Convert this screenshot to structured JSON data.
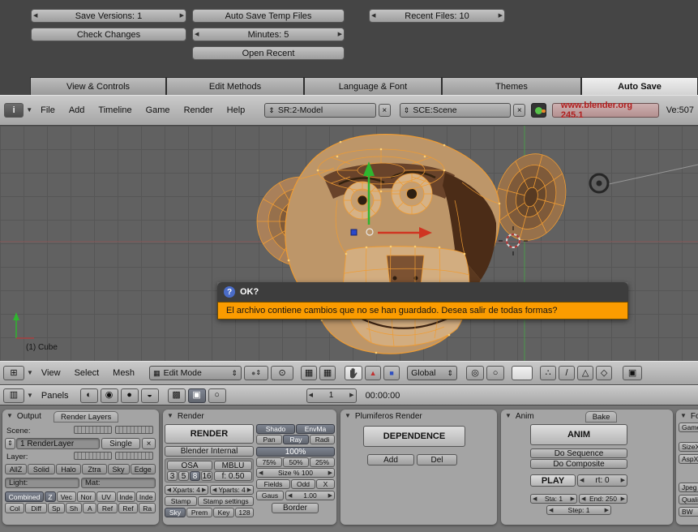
{
  "icons": {
    "down_triangle": "▼",
    "left_arrow": "◀",
    "right_arrow": "▶",
    "up_down": "⇕",
    "close": "×",
    "grid": "⊞",
    "mini_grid": "▦",
    "window": "▤",
    "buttons_window": "▥",
    "sphere": "●",
    "pivot": "⊙",
    "proportional": "◎",
    "ring": "○",
    "red_triangle": "▲",
    "blue_square": "■",
    "dots": "∴",
    "slash": "/",
    "outline_triangle": "△",
    "diamond": "◇",
    "image": "▣",
    "half_disc": "◐",
    "target": "◉",
    "contrast": "◒",
    "square_grid": "▩",
    "info": "i",
    "question": "?"
  },
  "prefs": {
    "save_versions": "Save Versions: 1",
    "auto_save_temp_files": "Auto Save Temp Files",
    "recent_files": "Recent Files: 10",
    "check_changes": "Check Changes",
    "minutes": "Minutes: 5",
    "open_recent": "Open Recent"
  },
  "tabs": {
    "items": [
      "View & Controls",
      "Edit Methods",
      "Language & Font",
      "Themes",
      "Auto Save"
    ]
  },
  "info_header": {
    "menus": [
      "File",
      "Add",
      "Timeline",
      "Game",
      "Render",
      "Help"
    ],
    "screen": "SR:2-Model",
    "scene": "SCE:Scene",
    "website": "www.blender.org 245.1",
    "version": "Ve:507"
  },
  "viewport": {
    "dialog": {
      "title": "OK?",
      "message": "El archivo contiene cambios que no se han guardado. Desea salir de todas formas?"
    },
    "object_label": "(1) Cube"
  },
  "viewport_header": {
    "menus": [
      "View",
      "Select",
      "Mesh"
    ],
    "mode": "Edit Mode",
    "orientation": "Global"
  },
  "buttons_header": {
    "panels_label": "Panels",
    "frame": "1",
    "time": "00:00:00"
  },
  "output_panel": {
    "title": "Output",
    "tab": "Render Layers",
    "scene_label": "Scene:",
    "layer_label": "Layer:",
    "renderlayer_name": "1 RenderLayer",
    "single": "Single",
    "light_label": "Light:",
    "mat_label": "Mat:",
    "visibility": [
      "AllZ",
      "Solid",
      "Halo",
      "Ztra",
      "Sky",
      "Edge"
    ],
    "passes_row1": [
      "Combined",
      "Z",
      "Vec",
      "Nor",
      "UV",
      "Inde",
      "Inde"
    ],
    "passes_row2": [
      "Col",
      "Diff",
      "Sp",
      "Sh",
      "A",
      "Ref",
      "Ref",
      "Ra"
    ]
  },
  "render_panel": {
    "title": "Render",
    "render_button": "RENDER",
    "engine": "Blender Internal",
    "shado": "Shado",
    "envma": "EnvMa",
    "pan": "Pan",
    "ray": "Ray",
    "radi": "Radi",
    "osa": "OSA",
    "mblu": "MBLU",
    "osa_levels": [
      "3",
      "5",
      "8",
      "16"
    ],
    "bf": "f: 0.50",
    "p100": "100%",
    "p75": "75%",
    "p50": "50%",
    "p25": "25%",
    "size_pct": "Size % 100",
    "fields": "Fields",
    "odd": "Odd",
    "x": "X",
    "xparts": "Xparts: 4",
    "yparts": "Yparts: 4",
    "stamp": "Stamp",
    "stamp_settings": "Stamp settings",
    "gaus": "Gaus",
    "gaus_val": "1.00",
    "sky": "Sky",
    "prem": "Prem",
    "key": "Key",
    "key_val": "128",
    "border": "Border"
  },
  "plumiferos_panel": {
    "title": "Plumiferos Render",
    "dependence": "DEPENDENCE",
    "add": "Add",
    "del": "Del"
  },
  "anim_panel": {
    "title": "Anim",
    "tab": "Bake",
    "anim_button": "ANIM",
    "do_sequence": "Do Sequence",
    "do_composite": "Do Composite",
    "play": "PLAY",
    "rt": "rt: 0",
    "sta": "Sta: 1",
    "end": "End: 250",
    "step": "Step: 1"
  },
  "format_panel": {
    "title": "Form",
    "game_f": "Game f",
    "sizex": "SizeX",
    "aspx": "AspX:",
    "jpeg": "Jpeg",
    "quality": "Quality",
    "bw": "BW"
  }
}
